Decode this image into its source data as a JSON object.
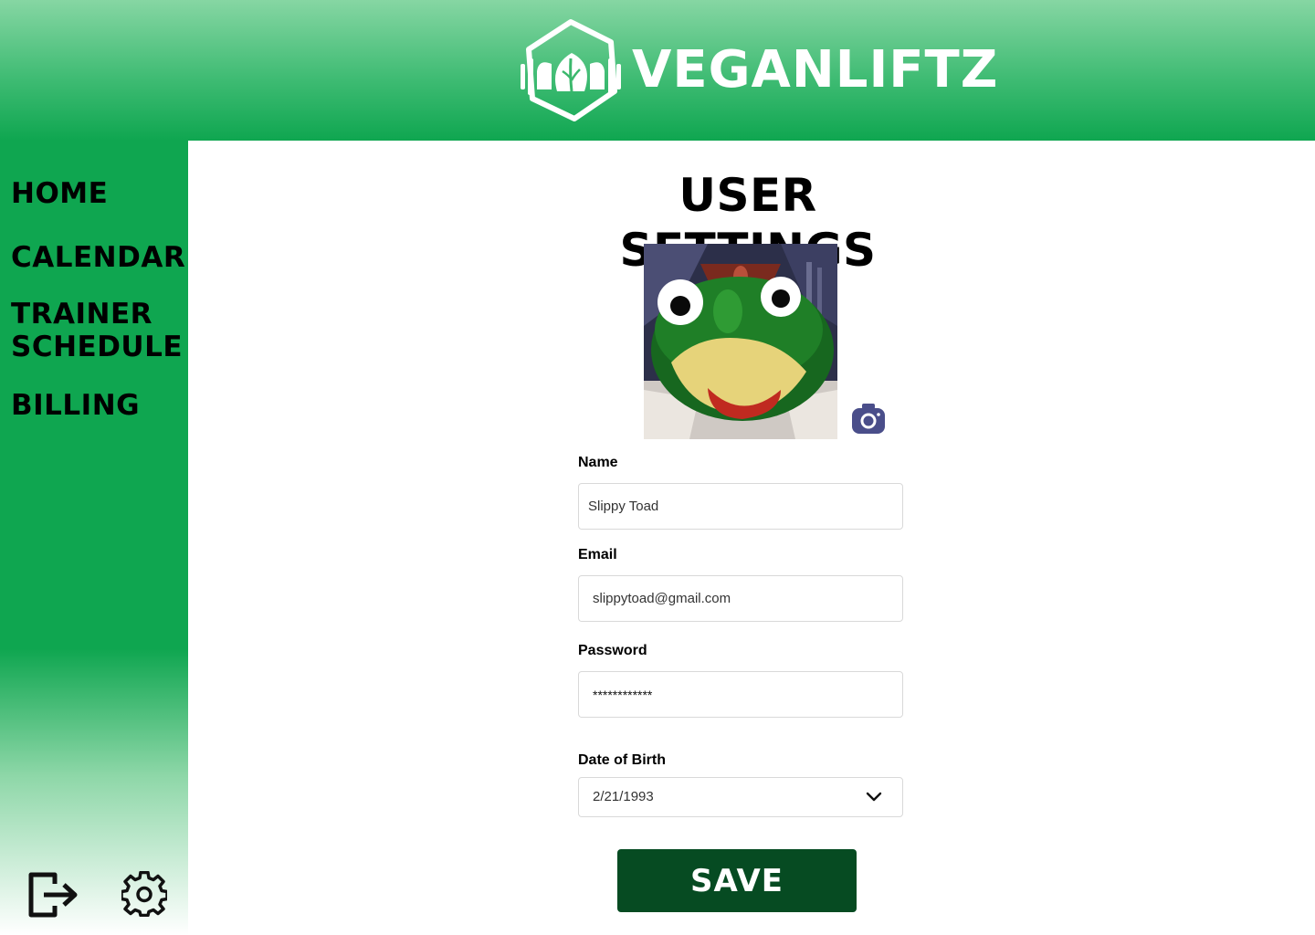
{
  "header": {
    "brand_name": "VEGANLIFTZ",
    "logo_icon": "hexagon-leaf-dumbbell-logo"
  },
  "sidebar": {
    "items": [
      {
        "label": "HOME"
      },
      {
        "label": "CALENDAR"
      },
      {
        "label": "TRAINER SCHEDULE"
      },
      {
        "label": "BILLING"
      }
    ],
    "footer_icons": [
      "logout-icon",
      "gear-icon"
    ]
  },
  "main": {
    "title": "USER SETTINGS",
    "avatar_icon": "frog-avatar",
    "camera_icon": "camera-icon",
    "fields": {
      "name": {
        "label": "Name",
        "value": "Slippy Toad"
      },
      "email": {
        "label": "Email",
        "value": "slippytoad@gmail.com"
      },
      "password": {
        "label": "Password",
        "value": "************"
      },
      "dob": {
        "label": "Date of Birth",
        "value": "2/21/1993"
      }
    },
    "save_label": "SAVE"
  },
  "colors": {
    "header_top": "#86d6a3",
    "sidebar_green": "#0fa650",
    "save_button": "#064b22",
    "camera_icon": "#4a4e8a"
  }
}
